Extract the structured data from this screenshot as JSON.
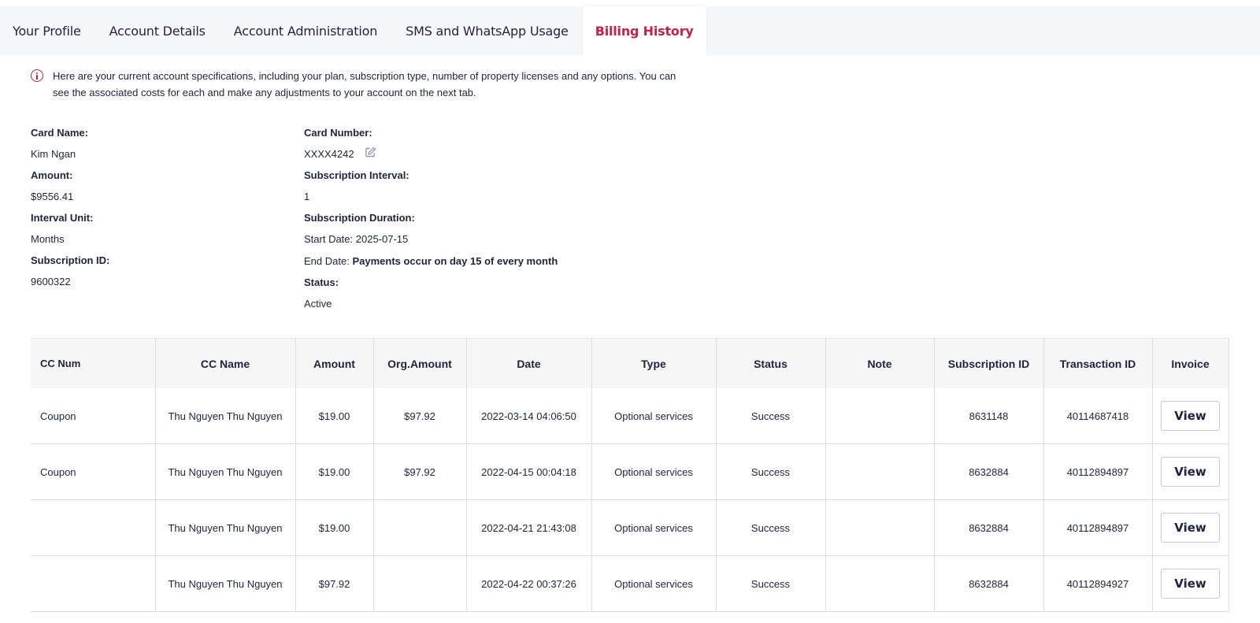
{
  "tabs": [
    {
      "label": "Your Profile"
    },
    {
      "label": "Account Details"
    },
    {
      "label": "Account Administration"
    },
    {
      "label": "SMS and WhatsApp Usage"
    },
    {
      "label": "Billing History",
      "active": true
    }
  ],
  "info": {
    "icon": "info-icon",
    "text": "Here are your current account specifications, including your plan, subscription type, number of property licenses and any options. You can see the associated costs for each and make any adjustments to your account on the next tab."
  },
  "details": {
    "card_name_label": "Card Name:",
    "card_name": "Kim Ngan",
    "amount_label": "Amount:",
    "amount": "$9556.41",
    "interval_unit_label": "Interval Unit:",
    "interval_unit": "Months",
    "subscription_id_label": "Subscription ID:",
    "subscription_id": "9600322",
    "card_number_label": "Card Number:",
    "card_number": "XXXX4242",
    "subscription_interval_label": "Subscription Interval:",
    "subscription_interval": "1",
    "subscription_duration_label": "Subscription Duration:",
    "start_date": "Start Date: 2025-07-15",
    "end_date_prefix": "End Date:",
    "end_date_value": "Payments occur on day 15 of every month",
    "status_label": "Status:",
    "status": "Active"
  },
  "table": {
    "headers": [
      "CC Num",
      "CC Name",
      "Amount",
      "Org.Amount",
      "Date",
      "Type",
      "Status",
      "Note",
      "Subscription ID",
      "Transaction ID",
      "Invoice"
    ],
    "view_label": "View",
    "rows": [
      {
        "cc_num": "Coupon",
        "cc_name": "Thu Nguyen Thu Nguyen",
        "amount": "$19.00",
        "org_amount": "$97.92",
        "date": "2022-03-14 04:06:50",
        "type": "Optional services",
        "status": "Success",
        "note": "",
        "subscription_id": "8631148",
        "transaction_id": "40114687418"
      },
      {
        "cc_num": "Coupon",
        "cc_name": "Thu Nguyen Thu Nguyen",
        "amount": "$19.00",
        "org_amount": "$97.92",
        "date": "2022-04-15 00:04:18",
        "type": "Optional services",
        "status": "Success",
        "note": "",
        "subscription_id": "8632884",
        "transaction_id": "40112894897"
      },
      {
        "cc_num": "",
        "cc_name": "Thu Nguyen Thu Nguyen",
        "amount": "$19.00",
        "org_amount": "",
        "date": "2022-04-21 21:43:08",
        "type": "Optional services",
        "status": "Success",
        "note": "",
        "subscription_id": "8632884",
        "transaction_id": "40112894897"
      },
      {
        "cc_num": "",
        "cc_name": "Thu Nguyen Thu Nguyen",
        "amount": "$97.92",
        "org_amount": "",
        "date": "2022-04-22 00:37:26",
        "type": "Optional services",
        "status": "Success",
        "note": "",
        "subscription_id": "8632884",
        "transaction_id": "40112894927"
      }
    ]
  },
  "colors": {
    "accent": "#c8204a",
    "text": "#1f2340",
    "tabbar_bg": "#f6f7fa",
    "header_bg": "#f6f6f7"
  }
}
